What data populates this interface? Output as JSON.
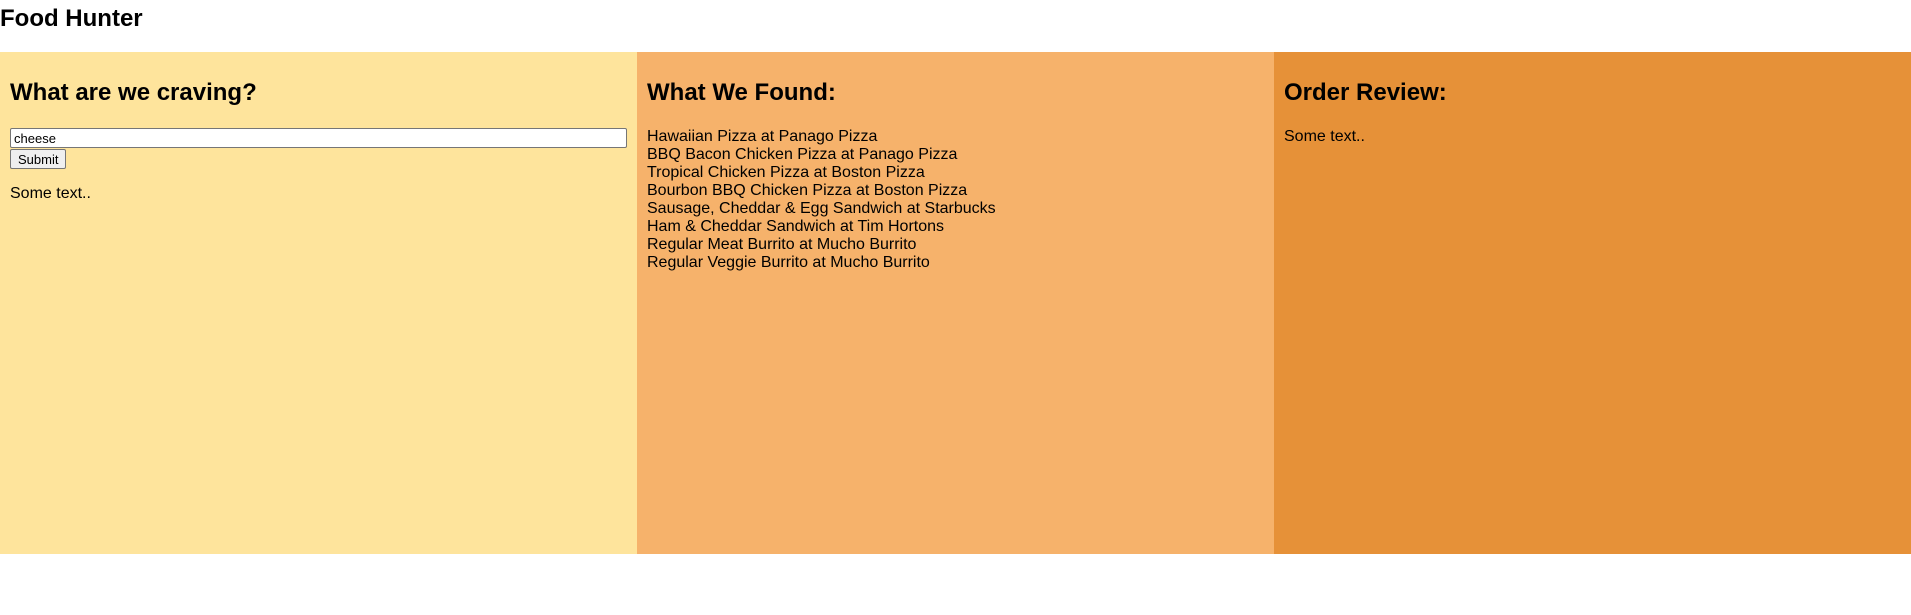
{
  "app": {
    "title": "Food Hunter"
  },
  "search": {
    "heading": "What are we craving?",
    "input_value": "cheese",
    "submit_label": "Submit",
    "text": "Some text.."
  },
  "found": {
    "heading": "What We Found:",
    "results": [
      "Hawaiian Pizza at Panago Pizza",
      "BBQ Bacon Chicken Pizza at Panago Pizza",
      "Tropical Chicken Pizza at Boston Pizza",
      "Bourbon BBQ Chicken Pizza at Boston Pizza",
      "Sausage, Cheddar & Egg Sandwich at Starbucks",
      "Ham & Cheddar Sandwich at Tim Hortons",
      "Regular Meat Burrito at Mucho Burrito",
      "Regular Veggie Burrito at Mucho Burrito"
    ]
  },
  "order": {
    "heading": "Order Review:",
    "text": "Some text.."
  },
  "colors": {
    "search_panel": "#fee49c",
    "found_panel": "#f6b26b",
    "order_panel": "#e69138"
  }
}
